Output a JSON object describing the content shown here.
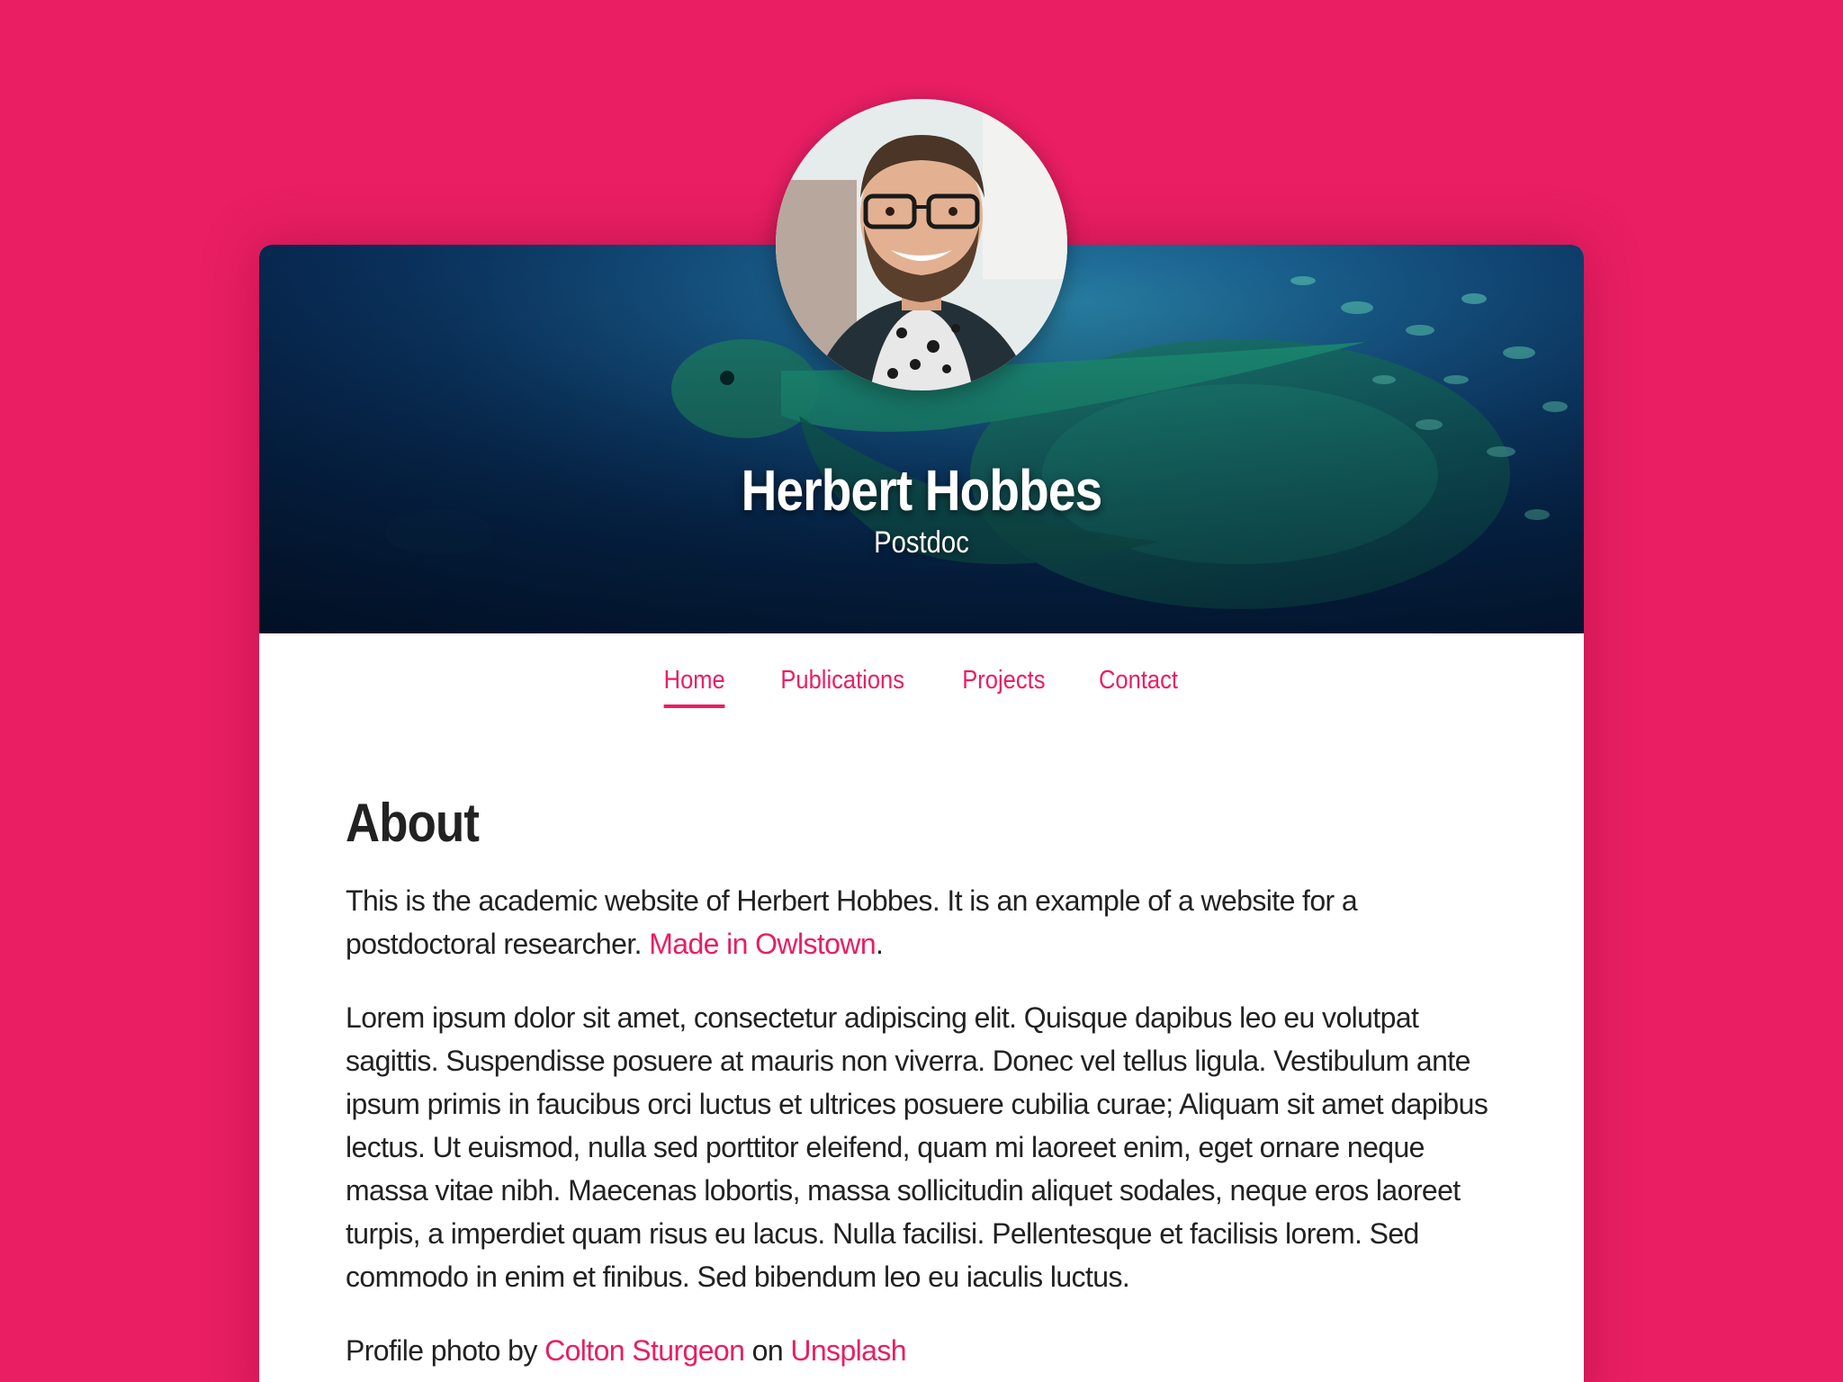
{
  "profile": {
    "name": "Herbert Hobbes",
    "role": "Postdoc",
    "avatar_icon": "portrait-photo"
  },
  "nav": {
    "items": [
      {
        "label": "Home",
        "active": true
      },
      {
        "label": "Publications",
        "active": false
      },
      {
        "label": "Projects",
        "active": false
      },
      {
        "label": "Contact",
        "active": false
      }
    ]
  },
  "about": {
    "heading": "About",
    "intro_text": "This is the academic website of Herbert Hobbes. It is an example of a website for a postdoctoral researcher.",
    "intro_link": "Made in Owlstown",
    "intro_end": ".",
    "lorem": "Lorem ipsum dolor sit amet, consectetur adipiscing elit. Quisque dapibus leo eu volutpat sagittis. Suspendisse posuere at mauris non viverra. Donec vel tellus ligula. Vestibulum ante ipsum primis in faucibus orci luctus et ultrices posuere cubilia curae; Aliquam sit amet dapibus lectus. Ut euismod, nulla sed porttitor eleifend, quam mi laoreet enim, eget ornare neque massa vitae nibh. Maecenas lobortis, massa sollicitudin aliquet sodales, neque eros laoreet turpis, a imperdiet quam risus eu lacus. Nulla facilisi. Pellentesque et facilisis lorem. Sed commodo in enim et finibus. Sed bibendum leo eu iaculis luctus."
  },
  "credit": {
    "prefix": "Profile photo by",
    "author_link": "Colton Sturgeon",
    "middle": "on",
    "site_link": "Unsplash"
  },
  "colors": {
    "accent": "#E91E63",
    "text": "#222222",
    "background": "#E91E63",
    "card": "#ffffff"
  }
}
